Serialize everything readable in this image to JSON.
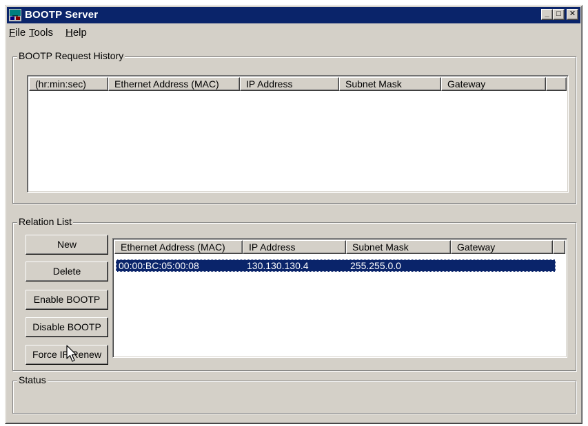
{
  "window": {
    "title": "BOOTP Server",
    "controls": {
      "minimize": "_",
      "maximize": "□",
      "close": "✕"
    }
  },
  "menu": [
    {
      "accel": "F",
      "rest": "ile"
    },
    {
      "accel": "T",
      "rest": "ools"
    },
    {
      "accel": "H",
      "rest": "elp"
    }
  ],
  "history": {
    "label": "BOOTP Request History",
    "columns": [
      "(hr:min:sec)",
      "Ethernet Address (MAC)",
      "IP Address",
      "Subnet Mask",
      "Gateway"
    ]
  },
  "relations": {
    "label": "Relation List",
    "buttons": {
      "new": "New",
      "delete": "Delete",
      "enable": "Enable BOOTP",
      "disable": "Disable BOOTP",
      "force": "Force IP Renew"
    },
    "columns": [
      "Ethernet Address (MAC)",
      "IP Address",
      "Subnet Mask",
      "Gateway"
    ],
    "rows": [
      {
        "mac": "00:00:BC:05:00:08",
        "ip": "130.130.130.4",
        "mask": "255.255.0.0",
        "gateway": "",
        "selected": true
      }
    ]
  },
  "status": {
    "label": "Status",
    "text": ""
  },
  "colors": {
    "title_bar": "#0a246a",
    "face": "#d4d0c8",
    "selection": "#0a246a"
  },
  "icons": [
    "app-icon",
    "minimize-icon",
    "maximize-icon",
    "close-icon",
    "mouse-pointer-icon"
  ]
}
